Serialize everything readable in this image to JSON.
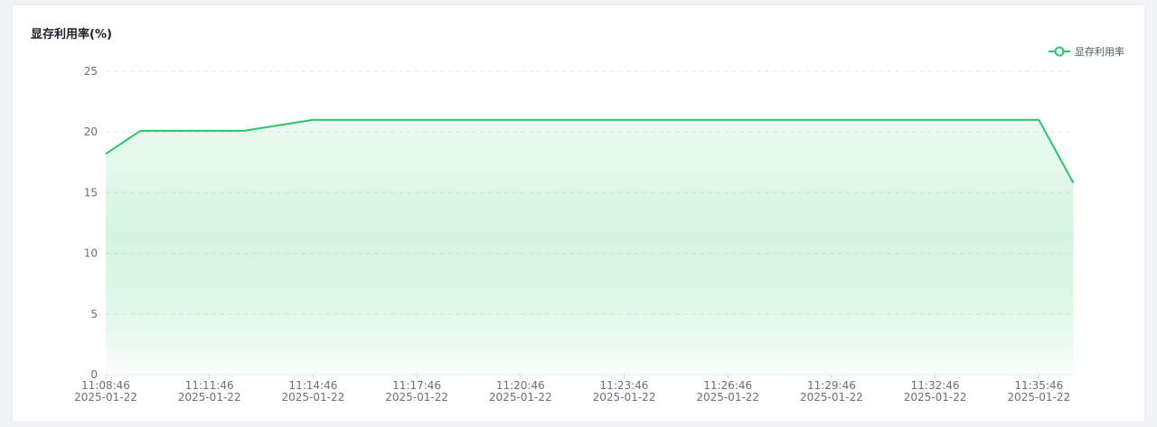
{
  "card": {
    "title": "显存利用率(%)"
  },
  "colors": {
    "line": "#2bc46a",
    "area": "#3ccf74",
    "grid": "#e6e8eb",
    "tick_text": "#6b6f76",
    "axis": "#cfd3d8"
  },
  "legend": {
    "icon": "circle-line-icon"
  },
  "chart_data": {
    "type": "area",
    "title": "显存利用率(%)",
    "xlabel": "",
    "ylabel": "",
    "ylim": [
      0,
      25
    ],
    "yticks": [
      0,
      5,
      10,
      15,
      20,
      25
    ],
    "y_tick_labels": [
      "0",
      "5",
      "10",
      "15",
      "20",
      "25"
    ],
    "x_tick_labels": [
      {
        "time": "11:08:46",
        "date": "2025-01-22"
      },
      {
        "time": "11:11:46",
        "date": "2025-01-22"
      },
      {
        "time": "11:14:46",
        "date": "2025-01-22"
      },
      {
        "time": "11:17:46",
        "date": "2025-01-22"
      },
      {
        "time": "11:20:46",
        "date": "2025-01-22"
      },
      {
        "time": "11:23:46",
        "date": "2025-01-22"
      },
      {
        "time": "11:26:46",
        "date": "2025-01-22"
      },
      {
        "time": "11:29:46",
        "date": "2025-01-22"
      },
      {
        "time": "11:32:46",
        "date": "2025-01-22"
      },
      {
        "time": "11:35:46",
        "date": "2025-01-22"
      }
    ],
    "legend": "top-right",
    "grid": true,
    "series": [
      {
        "name": "显存利用率",
        "points": [
          {
            "x": "2025-01-22 11:08:46",
            "y": 18.2
          },
          {
            "x": "2025-01-22 11:09:46",
            "y": 20.1
          },
          {
            "x": "2025-01-22 11:12:46",
            "y": 20.1
          },
          {
            "x": "2025-01-22 11:14:46",
            "y": 21.0
          },
          {
            "x": "2025-01-22 11:35:46",
            "y": 21.0
          },
          {
            "x": "2025-01-22 11:36:46",
            "y": 15.8
          }
        ]
      }
    ]
  }
}
